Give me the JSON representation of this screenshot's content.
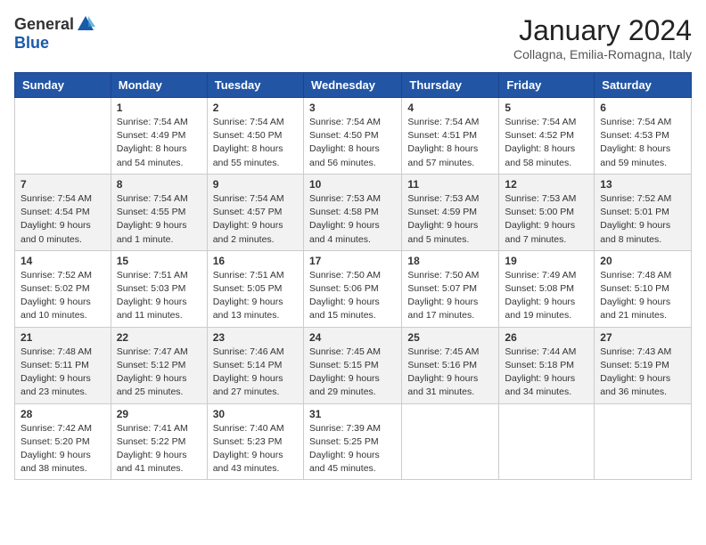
{
  "header": {
    "logo_general": "General",
    "logo_blue": "Blue",
    "month_title": "January 2024",
    "location": "Collagna, Emilia-Romagna, Italy"
  },
  "days_of_week": [
    "Sunday",
    "Monday",
    "Tuesday",
    "Wednesday",
    "Thursday",
    "Friday",
    "Saturday"
  ],
  "weeks": [
    [
      {
        "day": "",
        "info": ""
      },
      {
        "day": "1",
        "info": "Sunrise: 7:54 AM\nSunset: 4:49 PM\nDaylight: 8 hours\nand 54 minutes."
      },
      {
        "day": "2",
        "info": "Sunrise: 7:54 AM\nSunset: 4:50 PM\nDaylight: 8 hours\nand 55 minutes."
      },
      {
        "day": "3",
        "info": "Sunrise: 7:54 AM\nSunset: 4:50 PM\nDaylight: 8 hours\nand 56 minutes."
      },
      {
        "day": "4",
        "info": "Sunrise: 7:54 AM\nSunset: 4:51 PM\nDaylight: 8 hours\nand 57 minutes."
      },
      {
        "day": "5",
        "info": "Sunrise: 7:54 AM\nSunset: 4:52 PM\nDaylight: 8 hours\nand 58 minutes."
      },
      {
        "day": "6",
        "info": "Sunrise: 7:54 AM\nSunset: 4:53 PM\nDaylight: 8 hours\nand 59 minutes."
      }
    ],
    [
      {
        "day": "7",
        "info": "Sunrise: 7:54 AM\nSunset: 4:54 PM\nDaylight: 9 hours\nand 0 minutes."
      },
      {
        "day": "8",
        "info": "Sunrise: 7:54 AM\nSunset: 4:55 PM\nDaylight: 9 hours\nand 1 minute."
      },
      {
        "day": "9",
        "info": "Sunrise: 7:54 AM\nSunset: 4:57 PM\nDaylight: 9 hours\nand 2 minutes."
      },
      {
        "day": "10",
        "info": "Sunrise: 7:53 AM\nSunset: 4:58 PM\nDaylight: 9 hours\nand 4 minutes."
      },
      {
        "day": "11",
        "info": "Sunrise: 7:53 AM\nSunset: 4:59 PM\nDaylight: 9 hours\nand 5 minutes."
      },
      {
        "day": "12",
        "info": "Sunrise: 7:53 AM\nSunset: 5:00 PM\nDaylight: 9 hours\nand 7 minutes."
      },
      {
        "day": "13",
        "info": "Sunrise: 7:52 AM\nSunset: 5:01 PM\nDaylight: 9 hours\nand 8 minutes."
      }
    ],
    [
      {
        "day": "14",
        "info": "Sunrise: 7:52 AM\nSunset: 5:02 PM\nDaylight: 9 hours\nand 10 minutes."
      },
      {
        "day": "15",
        "info": "Sunrise: 7:51 AM\nSunset: 5:03 PM\nDaylight: 9 hours\nand 11 minutes."
      },
      {
        "day": "16",
        "info": "Sunrise: 7:51 AM\nSunset: 5:05 PM\nDaylight: 9 hours\nand 13 minutes."
      },
      {
        "day": "17",
        "info": "Sunrise: 7:50 AM\nSunset: 5:06 PM\nDaylight: 9 hours\nand 15 minutes."
      },
      {
        "day": "18",
        "info": "Sunrise: 7:50 AM\nSunset: 5:07 PM\nDaylight: 9 hours\nand 17 minutes."
      },
      {
        "day": "19",
        "info": "Sunrise: 7:49 AM\nSunset: 5:08 PM\nDaylight: 9 hours\nand 19 minutes."
      },
      {
        "day": "20",
        "info": "Sunrise: 7:48 AM\nSunset: 5:10 PM\nDaylight: 9 hours\nand 21 minutes."
      }
    ],
    [
      {
        "day": "21",
        "info": "Sunrise: 7:48 AM\nSunset: 5:11 PM\nDaylight: 9 hours\nand 23 minutes."
      },
      {
        "day": "22",
        "info": "Sunrise: 7:47 AM\nSunset: 5:12 PM\nDaylight: 9 hours\nand 25 minutes."
      },
      {
        "day": "23",
        "info": "Sunrise: 7:46 AM\nSunset: 5:14 PM\nDaylight: 9 hours\nand 27 minutes."
      },
      {
        "day": "24",
        "info": "Sunrise: 7:45 AM\nSunset: 5:15 PM\nDaylight: 9 hours\nand 29 minutes."
      },
      {
        "day": "25",
        "info": "Sunrise: 7:45 AM\nSunset: 5:16 PM\nDaylight: 9 hours\nand 31 minutes."
      },
      {
        "day": "26",
        "info": "Sunrise: 7:44 AM\nSunset: 5:18 PM\nDaylight: 9 hours\nand 34 minutes."
      },
      {
        "day": "27",
        "info": "Sunrise: 7:43 AM\nSunset: 5:19 PM\nDaylight: 9 hours\nand 36 minutes."
      }
    ],
    [
      {
        "day": "28",
        "info": "Sunrise: 7:42 AM\nSunset: 5:20 PM\nDaylight: 9 hours\nand 38 minutes."
      },
      {
        "day": "29",
        "info": "Sunrise: 7:41 AM\nSunset: 5:22 PM\nDaylight: 9 hours\nand 41 minutes."
      },
      {
        "day": "30",
        "info": "Sunrise: 7:40 AM\nSunset: 5:23 PM\nDaylight: 9 hours\nand 43 minutes."
      },
      {
        "day": "31",
        "info": "Sunrise: 7:39 AM\nSunset: 5:25 PM\nDaylight: 9 hours\nand 45 minutes."
      },
      {
        "day": "",
        "info": ""
      },
      {
        "day": "",
        "info": ""
      },
      {
        "day": "",
        "info": ""
      }
    ]
  ]
}
